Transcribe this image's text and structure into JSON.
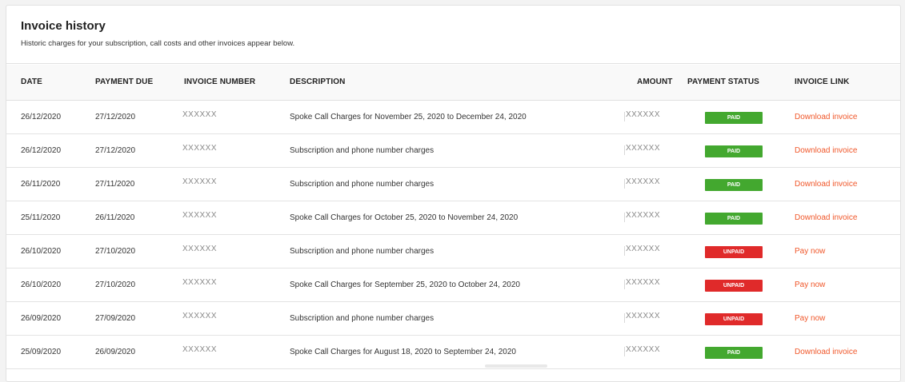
{
  "header": {
    "title": "Invoice history",
    "subtitle": "Historic charges for your subscription, call costs and other invoices appear below."
  },
  "columns": {
    "date": "DATE",
    "payment_due": "PAYMENT DUE",
    "invoice_number": "INVOICE NUMBER",
    "description": "DESCRIPTION",
    "amount": "AMOUNT",
    "payment_status": "PAYMENT STATUS",
    "invoice_link": "INVOICE LINK"
  },
  "colors": {
    "paid": "#43a82f",
    "unpaid": "#e02a2a",
    "link": "#f0572a"
  },
  "rows": [
    {
      "date": "26/12/2020",
      "due": "27/12/2020",
      "invoice": "XXXXXX",
      "description": "Spoke Call Charges for November 25, 2020 to December 24, 2020",
      "amount": "XXXXXX",
      "status": "PAID",
      "link": "Download invoice"
    },
    {
      "date": "26/12/2020",
      "due": "27/12/2020",
      "invoice": "XXXXXX",
      "description": "Subscription and phone number charges",
      "amount": "XXXXXX",
      "status": "PAID",
      "link": "Download invoice"
    },
    {
      "date": "26/11/2020",
      "due": "27/11/2020",
      "invoice": "XXXXXX",
      "description": "Subscription and phone number charges",
      "amount": "XXXXXX",
      "status": "PAID",
      "link": "Download invoice"
    },
    {
      "date": "25/11/2020",
      "due": "26/11/2020",
      "invoice": "XXXXXX",
      "description": "Spoke Call Charges for October 25, 2020 to November 24, 2020",
      "amount": "XXXXXX",
      "status": "PAID",
      "link": "Download invoice"
    },
    {
      "date": "26/10/2020",
      "due": "27/10/2020",
      "invoice": "XXXXXX",
      "description": "Subscription and phone number charges",
      "amount": "XXXXXX",
      "status": "UNPAID",
      "link": "Pay now"
    },
    {
      "date": "26/10/2020",
      "due": "27/10/2020",
      "invoice": "XXXXXX",
      "description": "Spoke Call Charges for September 25, 2020 to October 24, 2020",
      "amount": "XXXXXX",
      "status": "UNPAID",
      "link": "Pay now"
    },
    {
      "date": "26/09/2020",
      "due": "27/09/2020",
      "invoice": "XXXXXX",
      "description": "Subscription and phone number charges",
      "amount": "XXXXXX",
      "status": "UNPAID",
      "link": "Pay now"
    },
    {
      "date": "25/09/2020",
      "due": "26/09/2020",
      "invoice": "XXXXXX",
      "description": "Spoke Call Charges for August 18, 2020 to September 24, 2020",
      "amount": "XXXXXX",
      "status": "PAID",
      "link": "Download invoice"
    }
  ]
}
